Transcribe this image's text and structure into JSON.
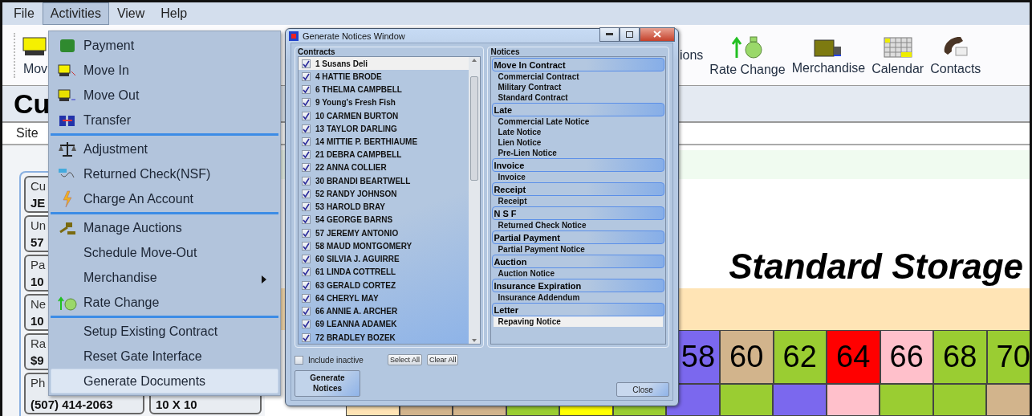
{
  "menu_bar": [
    {
      "label": "File",
      "selected": false
    },
    {
      "label": "Activities",
      "selected": true
    },
    {
      "label": "View",
      "selected": false
    },
    {
      "label": "Help",
      "selected": false
    }
  ],
  "toolbar": [
    {
      "label": "Mov"
    },
    {
      "label": "ions"
    },
    {
      "label": "Rate Change"
    },
    {
      "label": "Merchandise"
    },
    {
      "label": "Calendar"
    },
    {
      "label": "Contacts"
    }
  ],
  "page_title": "Cu",
  "tab_label": "Site",
  "customer_fields": [
    {
      "label": "Cu",
      "value": "JE"
    },
    {
      "label": "Un",
      "value": "57"
    },
    {
      "label": "Pa",
      "value": "10"
    },
    {
      "label": "Ne",
      "value": "10"
    },
    {
      "label": "Ra",
      "value": "$9"
    },
    {
      "label": "Ph",
      "value": "(507) 414-2063"
    }
  ],
  "unit_size": "10 X 10",
  "facility_name": "Standard Storage",
  "unit_row": [
    {
      "number": "58",
      "color": "#7b68ee"
    },
    {
      "number": "60",
      "color": "#d2b48c"
    },
    {
      "number": "62",
      "color": "#9acd32"
    },
    {
      "number": "64",
      "color": "#ff0000"
    },
    {
      "number": "66",
      "color": "#ffc0cb"
    },
    {
      "number": "68",
      "color": "#9acd32"
    },
    {
      "number": "70",
      "color": "#9acd32"
    }
  ],
  "unit_row_2": [
    {
      "color": "#ffe4b5"
    },
    {
      "color": "#d2b48c"
    },
    {
      "color": "#d2b48c"
    },
    {
      "color": "#9acd32"
    },
    {
      "color": "#ffff00"
    },
    {
      "color": "#9acd32"
    },
    {
      "color": "#7b68ee"
    },
    {
      "color": "#9acd32"
    },
    {
      "color": "#7b68ee"
    },
    {
      "color": "#ffc0cb"
    },
    {
      "color": "#9acd32"
    },
    {
      "color": "#9acd32"
    },
    {
      "color": "#d2b48c"
    }
  ],
  "menu": {
    "groups": [
      {
        "items": [
          {
            "label": "Payment",
            "has_submenu": false,
            "selected": false
          },
          {
            "label": "Move In",
            "has_submenu": false,
            "selected": false
          },
          {
            "label": "Move Out",
            "has_submenu": false,
            "selected": false
          },
          {
            "label": "Transfer",
            "has_submenu": false,
            "selected": false
          }
        ]
      },
      {
        "items": [
          {
            "label": "Adjustment",
            "has_submenu": false,
            "selected": false
          },
          {
            "label": "Returned Check(NSF)",
            "has_submenu": false,
            "selected": false
          },
          {
            "label": "Charge An Account",
            "has_submenu": false,
            "selected": false
          }
        ]
      },
      {
        "items": [
          {
            "label": "Manage Auctions",
            "has_submenu": false,
            "selected": false
          },
          {
            "label": "Schedule Move-Out",
            "has_submenu": false,
            "selected": false
          },
          {
            "label": "Merchandise",
            "has_submenu": true,
            "selected": false
          },
          {
            "label": "Rate Change",
            "has_submenu": false,
            "selected": false
          }
        ]
      },
      {
        "items": [
          {
            "label": "Setup Existing Contract",
            "has_submenu": false,
            "selected": false
          },
          {
            "label": "Reset Gate Interface",
            "has_submenu": false,
            "selected": false
          },
          {
            "label": "Generate Documents",
            "has_submenu": false,
            "selected": true
          }
        ]
      }
    ]
  },
  "dialog": {
    "title": "Generate Notices Window",
    "contracts_label": "Contracts",
    "contracts": [
      {
        "label": "1 Susans Deli",
        "checked": true,
        "selected": true
      },
      {
        "label": "4 HATTIE BRODE",
        "checked": true,
        "selected": false
      },
      {
        "label": "6 THELMA CAMPBELL",
        "checked": true,
        "selected": false
      },
      {
        "label": "9 Young's Fresh Fish",
        "checked": true,
        "selected": false
      },
      {
        "label": "10 CARMEN BURTON",
        "checked": true,
        "selected": false
      },
      {
        "label": "13 TAYLOR DARLING",
        "checked": true,
        "selected": false
      },
      {
        "label": "14 MITTIE P. BERTHIAUME",
        "checked": true,
        "selected": false
      },
      {
        "label": "21 DEBRA CAMPBELL",
        "checked": true,
        "selected": false
      },
      {
        "label": "22 ANNA COLLIER",
        "checked": true,
        "selected": false
      },
      {
        "label": "30 BRANDI BEARTWELL",
        "checked": true,
        "selected": false
      },
      {
        "label": "52 RANDY JOHNSON",
        "checked": true,
        "selected": false
      },
      {
        "label": "53 HAROLD BRAY",
        "checked": true,
        "selected": false
      },
      {
        "label": "54 GEORGE BARNS",
        "checked": true,
        "selected": false
      },
      {
        "label": "57 JEREMY ANTONIO",
        "checked": true,
        "selected": false
      },
      {
        "label": "58 MAUD MONTGOMERY",
        "checked": true,
        "selected": false
      },
      {
        "label": "60 SILVIA J. AGUIRRE",
        "checked": true,
        "selected": false
      },
      {
        "label": "61 LINDA COTTRELL",
        "checked": true,
        "selected": false
      },
      {
        "label": "63 GERALD CORTEZ",
        "checked": true,
        "selected": false
      },
      {
        "label": "64 CHERYL MAY",
        "checked": true,
        "selected": false
      },
      {
        "label": "66 ANNIE A. ARCHER",
        "checked": true,
        "selected": false
      },
      {
        "label": "69 LEANNA ADAMEK",
        "checked": true,
        "selected": false
      },
      {
        "label": "72 BRADLEY BOZEK",
        "checked": true,
        "selected": false
      }
    ],
    "include_inactive": {
      "label": "Include inactive",
      "checked": false
    },
    "select_all": "Select All",
    "clear_all": "Clear All",
    "generate_button": "Generate Notices",
    "notices_label": "Notices",
    "notice_groups": [
      {
        "title": "Move In Contract",
        "items": [
          {
            "label": "Commercial Contract",
            "selected": false
          },
          {
            "label": "Military Contract",
            "selected": false
          },
          {
            "label": "Standard Contract",
            "selected": false
          }
        ]
      },
      {
        "title": "Late",
        "items": [
          {
            "label": "Commercial Late Notice",
            "selected": false
          },
          {
            "label": "Late Notice",
            "selected": false
          },
          {
            "label": "Lien Notice",
            "selected": false
          },
          {
            "label": "Pre-Lien Notice",
            "selected": false
          }
        ]
      },
      {
        "title": "Invoice",
        "items": [
          {
            "label": "Invoice",
            "selected": false
          }
        ]
      },
      {
        "title": "Receipt",
        "items": [
          {
            "label": "Receipt",
            "selected": false
          }
        ]
      },
      {
        "title": "N S F",
        "items": [
          {
            "label": "Returned Check Notice",
            "selected": false
          }
        ]
      },
      {
        "title": "Partial Payment",
        "items": [
          {
            "label": "Partial Payment Notice",
            "selected": false
          }
        ]
      },
      {
        "title": "Auction",
        "items": [
          {
            "label": "Auction Notice",
            "selected": false
          }
        ]
      },
      {
        "title": "Insurance Expiration",
        "items": [
          {
            "label": "Insurance Addendum",
            "selected": false
          }
        ]
      },
      {
        "title": "Letter",
        "items": [
          {
            "label": "Repaving Notice",
            "selected": true
          }
        ]
      }
    ],
    "close_button": "Close"
  }
}
